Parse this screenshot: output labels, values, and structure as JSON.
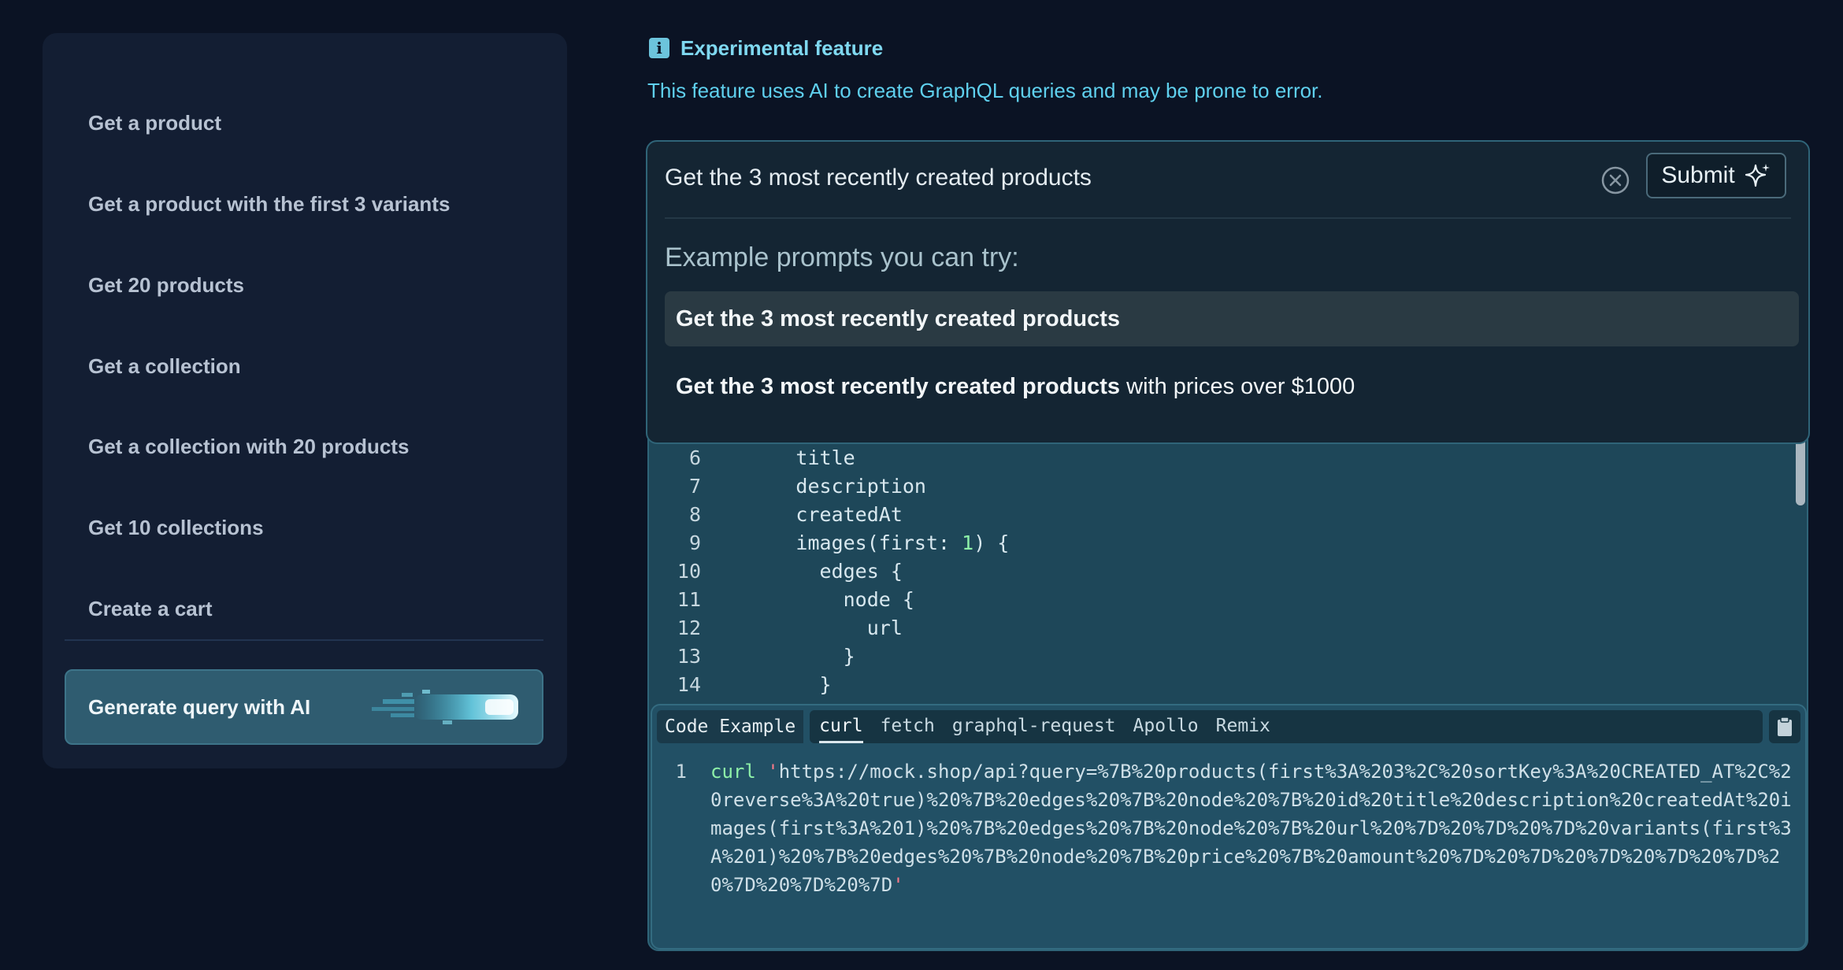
{
  "sidebar": {
    "items": [
      {
        "label": "Get a product"
      },
      {
        "label": "Get a product with the first 3 variants"
      },
      {
        "label": "Get 20 products"
      },
      {
        "label": "Get a collection"
      },
      {
        "label": "Get a collection with 20 products"
      },
      {
        "label": "Get 10 collections"
      },
      {
        "label": "Create a cart"
      }
    ],
    "generate_button": "Generate query with AI"
  },
  "notice": {
    "icon": "info-icon",
    "title": "Experimental feature",
    "description": "This feature uses AI to create GraphQL queries and may be prone to error."
  },
  "prompt": {
    "value": "Get the 3 most recently created products",
    "submit_label": "Submit",
    "examples_title": "Example prompts you can try:",
    "examples": [
      {
        "bold": "Get the 3 most recently created products",
        "rest": ""
      },
      {
        "bold": "Get the 3 most recently created products",
        "rest": " with prices over $1000"
      }
    ]
  },
  "editor": {
    "lines": [
      {
        "n": "6",
        "indent": "        ",
        "text": "title"
      },
      {
        "n": "7",
        "indent": "        ",
        "text": "description"
      },
      {
        "n": "8",
        "indent": "        ",
        "text": "createdAt"
      },
      {
        "n": "9",
        "indent": "        ",
        "text": "images(first: ",
        "num": "1",
        "after": ") {"
      },
      {
        "n": "10",
        "indent": "          ",
        "text": "edges {"
      },
      {
        "n": "11",
        "indent": "            ",
        "text": "node {"
      },
      {
        "n": "12",
        "indent": "              ",
        "text": "url"
      },
      {
        "n": "13",
        "indent": "            ",
        "text": "}"
      },
      {
        "n": "14",
        "indent": "          ",
        "text": "}"
      }
    ]
  },
  "code_example": {
    "title": "Code Example",
    "tabs": [
      "curl",
      "fetch",
      "graphql-request",
      "Apollo",
      "Remix"
    ],
    "active_tab": "curl",
    "line_number": "1",
    "keyword": "curl",
    "url": "https://mock.shop/api?query=%7B%20products(first%3A%203%2C%20sortKey%3A%20CREATED_AT%2C%20reverse%3A%20true)%20%7B%20edges%20%7B%20node%20%7B%20id%20title%20description%20createdAt%20images(first%3A%201)%20%7B%20edges%20%7B%20node%20%7B%20url%20%7D%20%7D%20%7D%20variants(first%3A%201)%20%7B%20edges%20%7B%20node%20%7B%20price%20%7B%20amount%20%7D%20%7D%20%7D%20%7D%20%7D%20%7D%20%7D%20%7D"
  },
  "colors": {
    "background": "#0b1324",
    "sidebar": "#131e33",
    "accent": "#5fd0ee",
    "editor": "#1e4759",
    "keyword": "#8ef0a8",
    "string_quote": "#ff7a8a"
  }
}
